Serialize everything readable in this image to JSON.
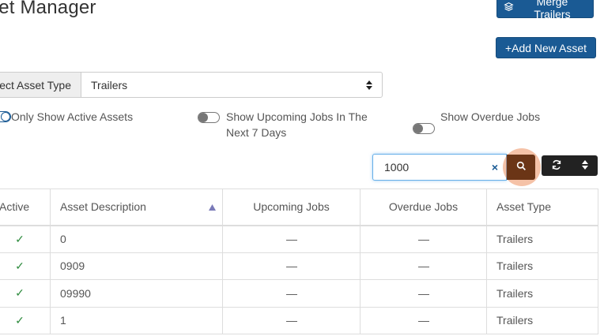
{
  "header": {
    "title": "set Manager",
    "merge_label": "Merge Trailers",
    "add_new_label": "+Add New Asset"
  },
  "asset_type": {
    "addon_label": "ect Asset Type",
    "selected": "Trailers"
  },
  "filters": {
    "active": {
      "label": "Only Show Active Assets",
      "on": true
    },
    "upcoming": {
      "label_line1": "Show Upcoming Jobs In The",
      "label_line2": "Next 7 Days",
      "on": false
    },
    "overdue": {
      "label": "Show Overdue Jobs",
      "on": false
    }
  },
  "search": {
    "value": "1000",
    "clear_label": "×"
  },
  "table": {
    "headers": [
      "Active",
      "Asset Description",
      "Upcoming Jobs",
      "Overdue Jobs",
      "Asset Type"
    ],
    "rows": [
      {
        "active": "✓",
        "description": "0",
        "upcoming": "—",
        "overdue": "—",
        "type": "Trailers"
      },
      {
        "active": "✓",
        "description": "0909",
        "upcoming": "—",
        "overdue": "—",
        "type": "Trailers"
      },
      {
        "active": "✓",
        "description": "09990",
        "upcoming": "—",
        "overdue": "—",
        "type": "Trailers"
      },
      {
        "active": "✓",
        "description": "1",
        "upcoming": "—",
        "overdue": "—",
        "type": "Trailers"
      }
    ]
  },
  "colors": {
    "primary": "#1a5a94",
    "search_button": "#6b3516",
    "check": "#2e8b3e"
  }
}
